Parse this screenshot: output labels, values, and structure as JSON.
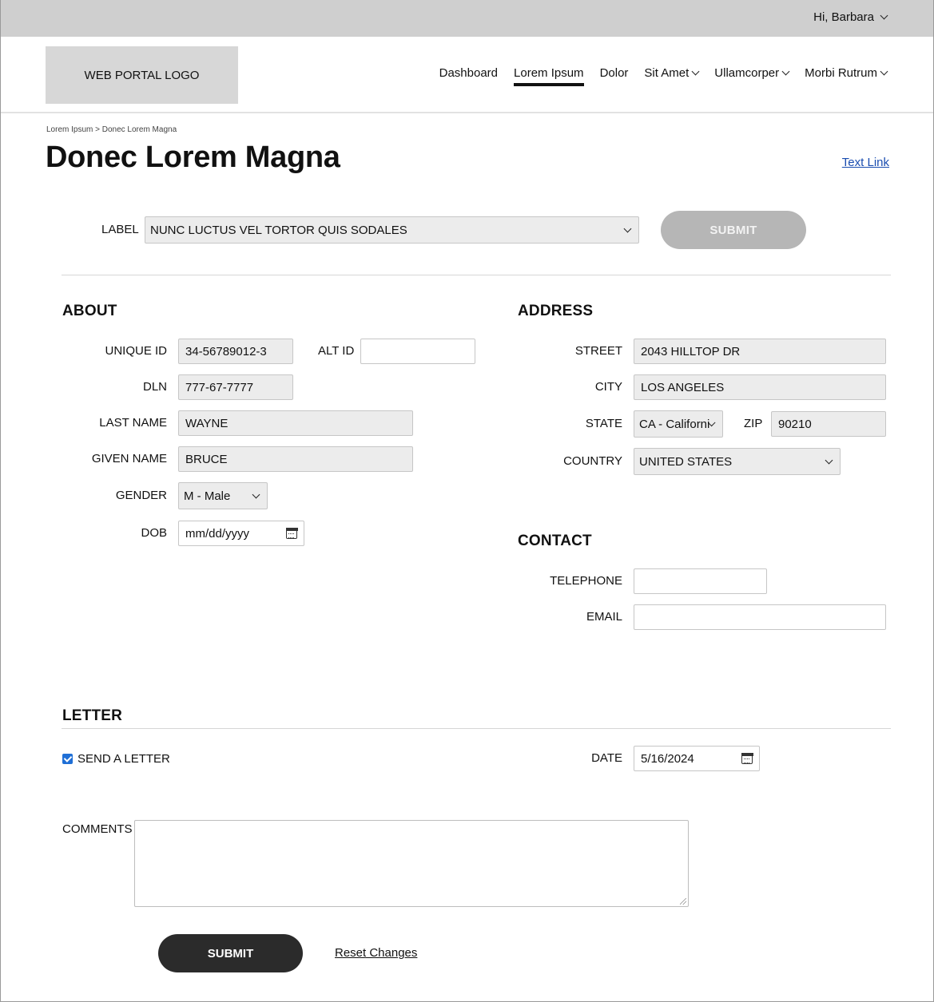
{
  "userbar": {
    "greeting": "Hi, Barbara"
  },
  "header": {
    "logo": "WEB PORTAL LOGO",
    "nav": [
      {
        "label": "Dashboard",
        "dropdown": false
      },
      {
        "label": "Lorem Ipsum",
        "dropdown": false,
        "active": true
      },
      {
        "label": "Dolor",
        "dropdown": false
      },
      {
        "label": "Sit Amet",
        "dropdown": true
      },
      {
        "label": "Ullamcorper",
        "dropdown": true
      },
      {
        "label": "Morbi Rutrum",
        "dropdown": true
      }
    ]
  },
  "page": {
    "breadcrumb": "Lorem Ipsum > Donec Lorem Magna",
    "title": "Donec Lorem Magna",
    "text_link": "Text Link"
  },
  "selector": {
    "label": "LABEL",
    "value": "NUNC LUCTUS VEL TORTOR QUIS SODALES",
    "submit": "SUBMIT"
  },
  "about": {
    "title": "ABOUT",
    "unique_id": {
      "label": "UNIQUE ID",
      "value": "34-56789012-3"
    },
    "alt_id": {
      "label": "ALT ID",
      "value": ""
    },
    "dln": {
      "label": "DLN",
      "value": "777-67-7777"
    },
    "last_name": {
      "label": "LAST NAME",
      "value": "WAYNE"
    },
    "given_name": {
      "label": "GIVEN NAME",
      "value": "BRUCE"
    },
    "gender": {
      "label": "GENDER",
      "value": "M - Male"
    },
    "dob": {
      "label": "DOB",
      "placeholder": "mm/dd/yyyy"
    }
  },
  "address": {
    "title": "ADDRESS",
    "street": {
      "label": "STREET",
      "value": "2043 HILLTOP DR"
    },
    "city": {
      "label": "CITY",
      "value": "LOS ANGELES"
    },
    "state": {
      "label": "STATE",
      "value": "CA - Californi"
    },
    "zip": {
      "label": "ZIP",
      "value": "90210"
    },
    "country": {
      "label": "COUNTRY",
      "value": "UNITED STATES"
    }
  },
  "contact": {
    "title": "CONTACT",
    "telephone": {
      "label": "TELEPHONE",
      "value": ""
    },
    "email": {
      "label": "EMAIL",
      "value": ""
    }
  },
  "letter": {
    "title": "LETTER",
    "send_label": "SEND A LETTER",
    "send_checked": true,
    "date": {
      "label": "DATE",
      "value": "5/16/2024"
    },
    "comments_label": "COMMENTS",
    "comments_value": ""
  },
  "actions": {
    "submit": "SUBMIT",
    "reset": "Reset Changes"
  },
  "colors": {
    "accent": "#1f6fd6",
    "link": "#1a4db0",
    "primary_button": "#2b2b2b",
    "disabled_button": "#b6b6b6"
  }
}
